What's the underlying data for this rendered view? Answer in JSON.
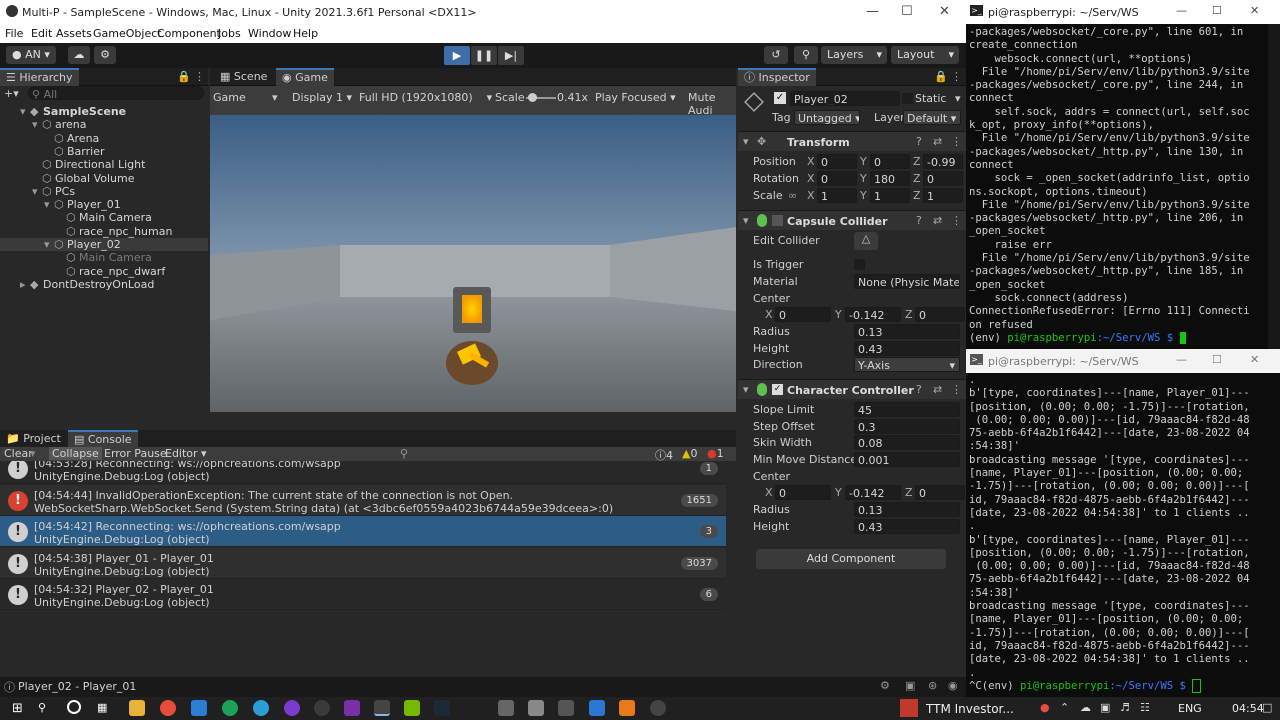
{
  "unity": {
    "title": "Multi-P - SampleScene - Windows, Mac, Linux - Unity 2021.3.6f1 Personal <DX11>",
    "menu": [
      "File",
      "Edit",
      "Assets",
      "GameObject",
      "Component",
      "Jobs",
      "Window",
      "Help"
    ],
    "account": "AN",
    "layers": "Layers",
    "layout": "Layout",
    "hierarchy": {
      "tab": "Hierarchy",
      "search_placeholder": "All",
      "items": [
        {
          "label": "SampleScene",
          "depth": 0
        },
        {
          "label": "arena",
          "depth": 1
        },
        {
          "label": "Arena",
          "depth": 2
        },
        {
          "label": "Barrier",
          "depth": 2
        },
        {
          "label": "Directional Light",
          "depth": 1
        },
        {
          "label": "Global Volume",
          "depth": 1
        },
        {
          "label": "PCs",
          "depth": 1
        },
        {
          "label": "Player_01",
          "depth": 2
        },
        {
          "label": "Main Camera",
          "depth": 3
        },
        {
          "label": "race_npc_human",
          "depth": 3
        },
        {
          "label": "Player_02",
          "depth": 2
        },
        {
          "label": "Main Camera",
          "depth": 3
        },
        {
          "label": "race_npc_dwarf",
          "depth": 3
        },
        {
          "label": "DontDestroyOnLoad",
          "depth": 0
        }
      ]
    },
    "scene": {
      "tabs": [
        "Scene",
        "Game"
      ],
      "display_mode": "Game",
      "display": "Display 1",
      "resolution": "Full HD (1920x1080)",
      "scale_label": "Scale",
      "scale_value": "0.41x",
      "play_focused": "Play Focused",
      "mute": "Mute Audi"
    },
    "inspector": {
      "tab": "Inspector",
      "object_name": "Player_02",
      "static": "Static",
      "tag_label": "Tag",
      "tag": "Untagged",
      "layer_label": "Layer",
      "layer": "Default",
      "transform": {
        "title": "Transform",
        "position_label": "Position",
        "rotation_label": "Rotation",
        "scale_label": "Scale",
        "position": [
          "0",
          "0",
          "-0.99"
        ],
        "rotation": [
          "0",
          "180",
          "0"
        ],
        "scale": [
          "1",
          "1",
          "1"
        ]
      },
      "capsule": {
        "title": "Capsule Collider",
        "edit_collider": "Edit Collider",
        "is_trigger": "Is Trigger",
        "material_label": "Material",
        "material": "None (Physic Mate",
        "center_label": "Center",
        "center": [
          "0",
          "-0.142",
          "0"
        ],
        "radius_label": "Radius",
        "radius": "0.13",
        "height_label": "Height",
        "height": "0.43",
        "direction_label": "Direction",
        "direction": "Y-Axis"
      },
      "cc": {
        "title": "Character Controller",
        "slope_label": "Slope Limit",
        "slope": "45",
        "step_label": "Step Offset",
        "step": "0.3",
        "skin_label": "Skin Width",
        "skin": "0.08",
        "minmove_label": "Min Move Distance",
        "minmove": "0.001",
        "center_label": "Center",
        "center": [
          "0",
          "-0.142",
          "0"
        ],
        "radius_label": "Radius",
        "radius": "0.13",
        "height_label": "Height",
        "height": "0.43"
      },
      "add_component": "Add Component"
    },
    "console": {
      "tabs": [
        "Project",
        "Console"
      ],
      "clear": "Clear",
      "collapse": "Collapse",
      "error_pause": "Error Pause",
      "editor": "Editor",
      "count_warn": "4",
      "count_info": "0",
      "count_err": "1",
      "rows": [
        {
          "l1": "[04:53:28] Reconnecting: ws://ophcreations.com/wsapp",
          "l2": "UnityEngine.Debug:Log (object)",
          "count": "1",
          "type": "info"
        },
        {
          "l1": "[04:54:44] InvalidOperationException: The current state of the connection is not Open.",
          "l2": "WebSocketSharp.WebSocket.Send (System.String data) (at <3dbc6ef0559a4023b6744a59e39dceea>:0)",
          "count": "1651",
          "type": "error"
        },
        {
          "l1": "[04:54:42] Reconnecting: ws://ophcreations.com/wsapp",
          "l2": "UnityEngine.Debug:Log (object)",
          "count": "3",
          "type": "info"
        },
        {
          "l1": "[04:54:38] Player_01 - Player_01",
          "l2": "UnityEngine.Debug:Log (object)",
          "count": "3037",
          "type": "info"
        },
        {
          "l1": "[04:54:32] Player_02 - Player_01",
          "l2": "UnityEngine.Debug:Log (object)",
          "count": "6",
          "type": "info"
        }
      ]
    },
    "status": "Player_02 - Player_01"
  },
  "term1": {
    "title": "pi@raspberrypi: ~/Serv/WS",
    "lines": [
      "-packages/websocket/_core.py\", line 601, in",
      "create_connection",
      "    websock.connect(url, **options)",
      "  File \"/home/pi/Serv/env/lib/python3.9/site",
      "-packages/websocket/_core.py\", line 244, in",
      "connect",
      "    self.sock, addrs = connect(url, self.soc",
      "k_opt, proxy_info(**options),",
      "  File \"/home/pi/Serv/env/lib/python3.9/site",
      "-packages/websocket/_http.py\", line 130, in",
      "connect",
      "    sock = _open_socket(addrinfo_list, optio",
      "ns.sockopt, options.timeout)",
      "  File \"/home/pi/Serv/env/lib/python3.9/site",
      "-packages/websocket/_http.py\", line 206, in",
      "_open_socket",
      "    raise err",
      "  File \"/home/pi/Serv/env/lib/python3.9/site",
      "-packages/websocket/_http.py\", line 185, in",
      "_open_socket",
      "    sock.connect(address)",
      "ConnectionRefusedError: [Errno 111] Connecti",
      "on refused"
    ],
    "prompt_env": "(env) ",
    "prompt_user": "pi@raspberrypi",
    "prompt_path": ":~/Serv/WS $ "
  },
  "term2": {
    "title": "pi@raspberrypi: ~/Serv/WS",
    "lines": [
      ".",
      "b'[type, coordinates]---[name, Player_01]---",
      "[position, (0.00; 0.00; -1.75)]---[rotation,",
      " (0.00; 0.00; 0.00)]---[id, 79aaac84-f82d-48",
      "75-aebb-6f4a2b1f6442]---[date, 23-08-2022 04",
      ":54:38]'",
      "broadcasting message '[type, coordinates]---",
      "[name, Player_01]---[position, (0.00; 0.00;",
      "-1.75)]---[rotation, (0.00; 0.00; 0.00)]---[",
      "id, 79aaac84-f82d-4875-aebb-6f4a2b1f6442]---",
      "[date, 23-08-2022 04:54:38]' to 1 clients ..",
      ".",
      "b'[type, coordinates]---[name, Player_01]---",
      "[position, (0.00; 0.00; -1.75)]---[rotation,",
      " (0.00; 0.00; 0.00)]---[id, 79aaac84-f82d-48",
      "75-aebb-6f4a2b1f6442]---[date, 23-08-2022 04",
      ":54:38]'",
      "broadcasting message '[type, coordinates]---",
      "[name, Player_01]---[position, (0.00; 0.00;",
      "-1.75)]---[rotation, (0.00; 0.00; 0.00)]---[",
      "id, 79aaac84-f82d-4875-aebb-6f4a2b1f6442]---",
      "[date, 23-08-2022 04:54:38]' to 1 clients ..",
      "."
    ],
    "prompt_env": "^C(env) ",
    "prompt_user": "pi@raspberrypi",
    "prompt_path": ":~/Serv/WS $ "
  },
  "taskbar": {
    "stock": "TTM  Investor...",
    "lang": "ENG",
    "time": "04:54"
  }
}
